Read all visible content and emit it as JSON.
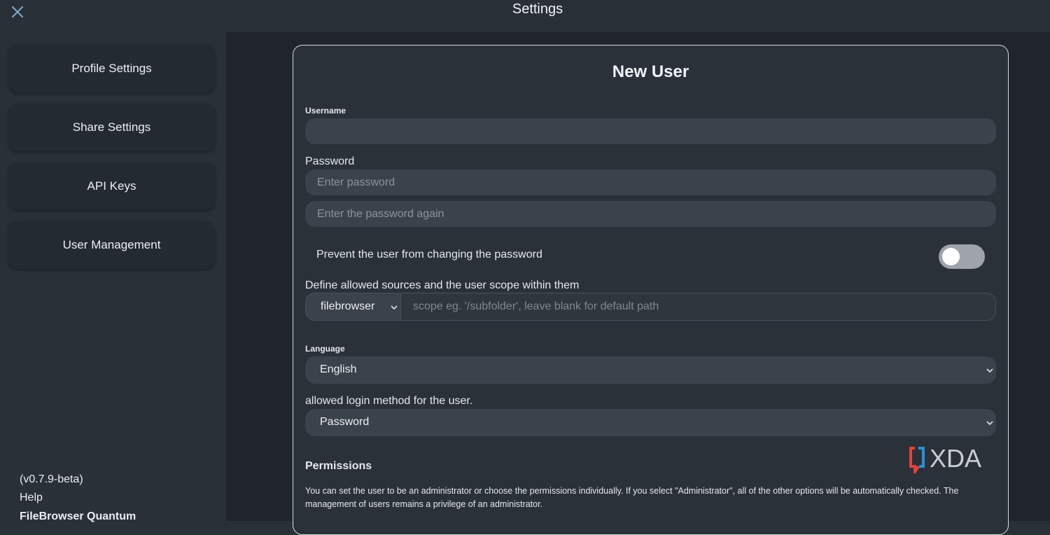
{
  "header": {
    "title": "Settings",
    "close_icon": "close-icon"
  },
  "sidebar": {
    "items": [
      {
        "label": "Profile Settings"
      },
      {
        "label": "Share Settings"
      },
      {
        "label": "API Keys"
      },
      {
        "label": "User Management"
      }
    ],
    "footer": {
      "version": "(v0.7.9-beta)",
      "help": "Help",
      "app_name": "FileBrowser Quantum"
    }
  },
  "form": {
    "title": "New User",
    "username": {
      "label": "Username",
      "value": "",
      "placeholder": ""
    },
    "password": {
      "label": "Password",
      "placeholder": "Enter password",
      "confirm_placeholder": "Enter the password again"
    },
    "prevent_change": {
      "label": "Prevent the user from changing the password",
      "enabled": false
    },
    "scope": {
      "label": "Define allowed sources and the user scope within them",
      "source": "filebrowser",
      "placeholder": "scope eg. '/subfolder', leave blank for default path"
    },
    "language": {
      "label": "Language",
      "value": "English"
    },
    "login_method": {
      "label": "allowed login method for the user.",
      "value": "Password"
    },
    "permissions": {
      "title": "Permissions",
      "description": "You can set the user to be an administrator or choose the permissions individually. If you select \"Administrator\", all of the other options will be automatically checked. The management of users remains a privilege of an administrator."
    }
  },
  "watermark": {
    "text": "XDA"
  },
  "colors": {
    "background": "#293038",
    "main_background": "#1f252b",
    "card": "#2a3139",
    "field": "#3a424b",
    "watermark_accent": "#e8403a",
    "watermark_accent2": "#2f8fd6"
  }
}
